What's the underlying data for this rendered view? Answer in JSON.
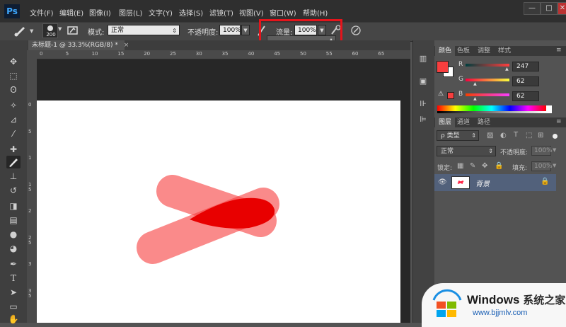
{
  "app": {
    "logo": "Ps"
  },
  "menu": [
    "文件(F)",
    "编辑(E)",
    "图像(I)",
    "图层(L)",
    "文字(Y)",
    "选择(S)",
    "滤镜(T)",
    "视图(V)",
    "窗口(W)",
    "帮助(H)"
  ],
  "window_buttons": {
    "minimize": "—",
    "maximize": "□",
    "close": "✕"
  },
  "options": {
    "brush_size": "200",
    "mode_label": "模式:",
    "mode_value": "正常",
    "opacity_label": "不透明度:",
    "opacity_value": "100%",
    "flow_label": "流量:",
    "flow_value": "100%",
    "flow_slider": 1.0
  },
  "document": {
    "tab_title": "未标题-1 @ 33.3%(RGB/8) *",
    "ruler_h": [
      "0",
      "5",
      "10",
      "15",
      "20",
      "25",
      "30",
      "35",
      "40",
      "45",
      "50",
      "55",
      "60",
      "65"
    ],
    "ruler_v": [
      "0",
      "5",
      "1",
      "1 5",
      "2",
      "2 5",
      "3",
      "3 5"
    ],
    "foreground_color": "#f73e3e"
  },
  "color_panel": {
    "tabs": [
      "颜色",
      "色板",
      "调整",
      "样式"
    ],
    "channels": [
      {
        "label": "R",
        "value": "247",
        "fraction": 0.969
      },
      {
        "label": "G",
        "value": "62",
        "fraction": 0.243
      },
      {
        "label": "B",
        "value": "62",
        "fraction": 0.243
      }
    ]
  },
  "layers_panel": {
    "tabs": [
      "图层",
      "通道",
      "路径"
    ],
    "filter_label": "ρ 类型",
    "blend_mode": "正常",
    "opacity_label": "不透明度:",
    "opacity_value": "100%",
    "lock_label": "锁定:",
    "fill_label": "填充:",
    "fill_value": "100%",
    "layer_name": "背景"
  },
  "watermark": {
    "brand": "Windows",
    "suffix": "系统之家",
    "url": "www.bjjmlv.com"
  }
}
